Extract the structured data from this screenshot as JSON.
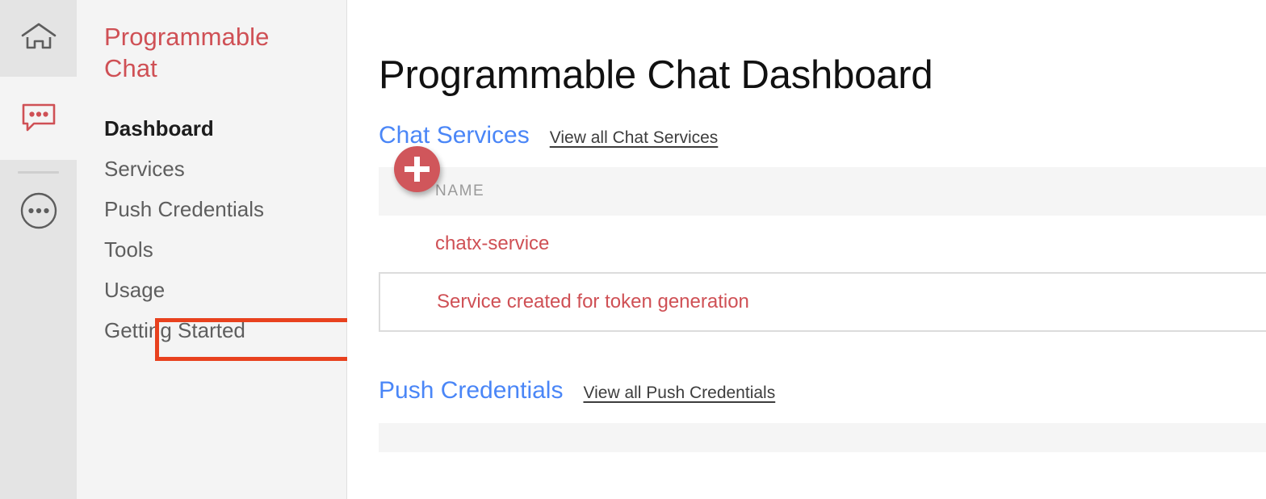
{
  "icon_rail": {
    "items": [
      {
        "name": "home-icon",
        "label": "Home",
        "active": false
      },
      {
        "name": "chat-icon",
        "label": "Programmable Chat",
        "active": true
      },
      {
        "name": "more-icon",
        "label": "All Products",
        "active": false
      }
    ]
  },
  "sidebar": {
    "product_title": "Programmable Chat",
    "items": [
      {
        "label": "Dashboard",
        "active": true,
        "highlighted": false
      },
      {
        "label": "Services",
        "active": false,
        "highlighted": false
      },
      {
        "label": "Push Credentials",
        "active": false,
        "highlighted": false
      },
      {
        "label": "Tools",
        "active": false,
        "highlighted": true
      },
      {
        "label": "Usage",
        "active": false,
        "highlighted": false
      },
      {
        "label": "Getting Started",
        "active": false,
        "highlighted": false
      }
    ],
    "highlight_color": "#e8411e"
  },
  "main": {
    "page_title": "Programmable Chat Dashboard",
    "sections": [
      {
        "title": "Chat Services",
        "link": "View all Chat Services",
        "add_button_label": "+",
        "columns": [
          "NAME"
        ],
        "rows": [
          {
            "name": "chatx-service",
            "bordered": false
          },
          {
            "name": "Service created for token generation",
            "bordered": true
          }
        ]
      },
      {
        "title": "Push Credentials",
        "link": "View all Push Credentials",
        "columns": [],
        "rows": []
      }
    ]
  },
  "colors": {
    "brand_red": "#cf5055",
    "link_blue": "#4a86f7",
    "highlight_orange": "#e8411e",
    "rail_bg": "#e4e4e4",
    "sidebar_bg": "#f4f4f4",
    "table_header_bg": "#f5f5f5"
  }
}
